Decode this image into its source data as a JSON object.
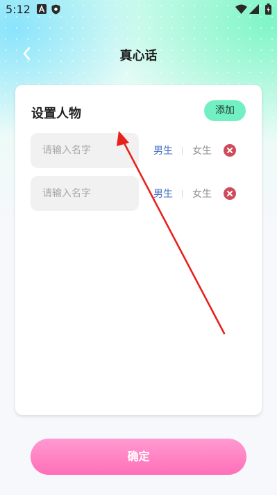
{
  "status_bar": {
    "time": "5:12"
  },
  "header": {
    "title": "真心话"
  },
  "card": {
    "title": "设置人物",
    "add_label": "添加",
    "rows": [
      {
        "placeholder": "请输入名字",
        "male_label": "男生",
        "female_label": "女生"
      },
      {
        "placeholder": "请输入名字",
        "male_label": "男生",
        "female_label": "女生"
      }
    ]
  },
  "footer": {
    "confirm_label": "确定"
  },
  "colors": {
    "accent_green": "#72f0c4",
    "confirm_pink": "#ff6fb8",
    "selected_gender": "#3f6ec3",
    "delete_red": "#cf4b5c",
    "annotation_arrow": "#e8211d"
  },
  "icons": [
    "android-a-icon",
    "shield-icon",
    "wifi-icon",
    "signal-icon",
    "battery-icon",
    "back-chevron-icon",
    "delete-icon"
  ]
}
